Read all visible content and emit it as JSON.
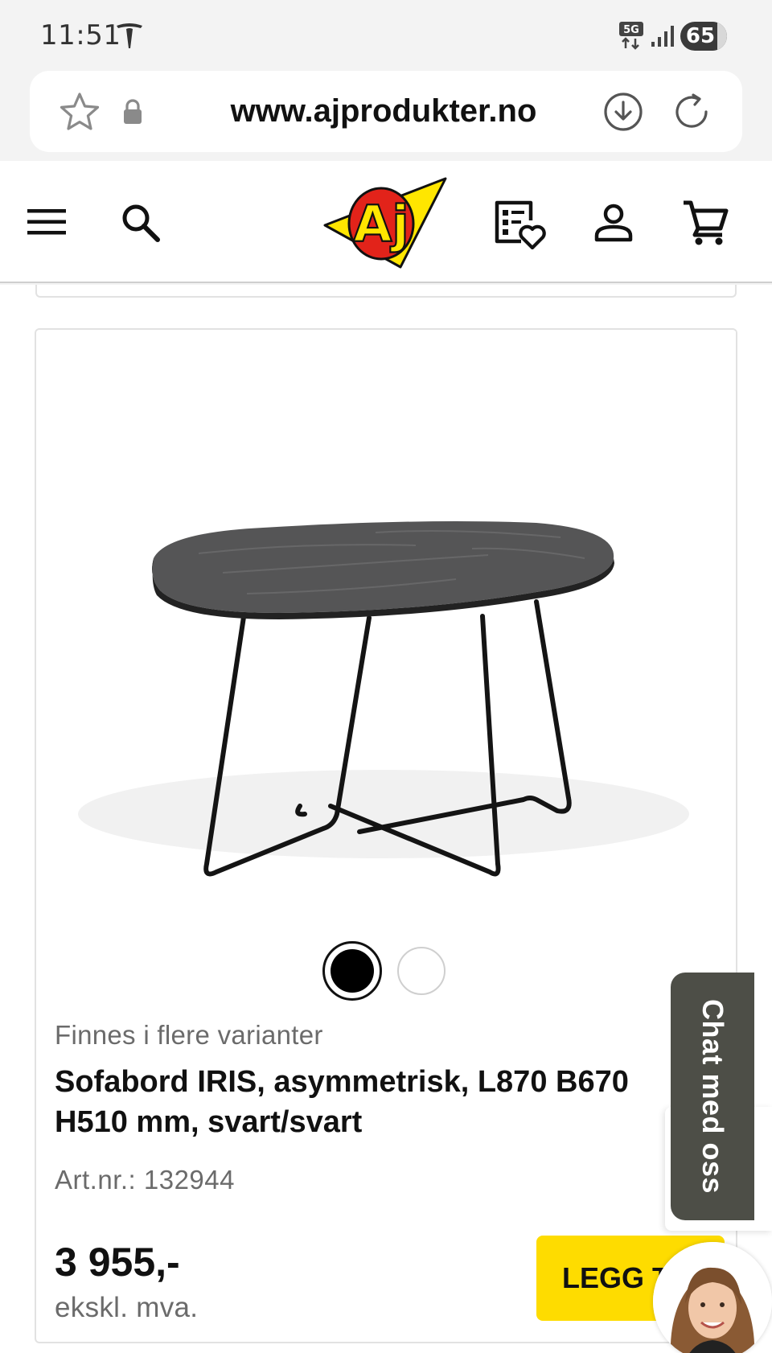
{
  "status_bar": {
    "time": "11:51",
    "network": "5G",
    "battery": "65"
  },
  "browser": {
    "url": "www.ajprodukter.no"
  },
  "site_header": {
    "logo_text": "Aj"
  },
  "product": {
    "variants_text": "Finnes i flere varianter",
    "title": "Sofabord IRIS, asymmetrisk, L870 B670 H510 mm, svart/svart",
    "article_number": "Art.nr.: 132944",
    "price": "3 955,-",
    "vat_note": "ekskl. mva.",
    "add_button_label": "LEGG TIL"
  },
  "chat": {
    "label": "Chat med oss"
  },
  "colors": {
    "accent_yellow": "#fedc00",
    "logo_red": "#e2231a",
    "chat_bg": "#4d4e47"
  }
}
